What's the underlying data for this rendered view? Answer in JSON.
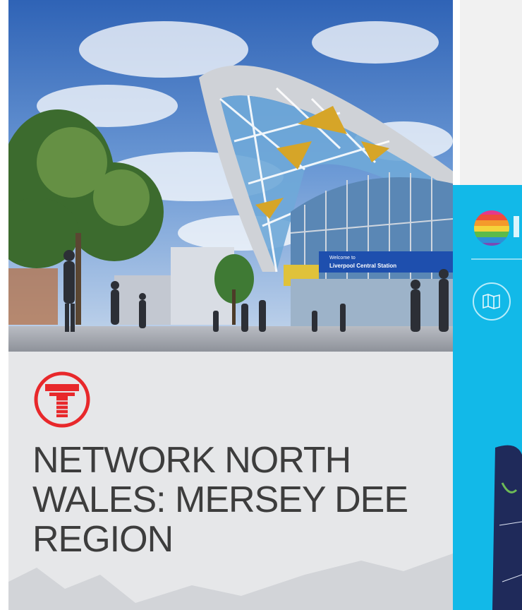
{
  "hero": {
    "sign_line1": "Welcome to",
    "sign_line2": "Liverpool Central Station"
  },
  "title_lines": [
    "NETWORK NORTH",
    "WALES: MERSEY DEE",
    "REGION"
  ],
  "colors": {
    "logo_red": "#e8282b",
    "title_gray": "#3d3d3d",
    "card_bg": "#e6e7e9",
    "right_panel_cyan": "#12b9e8",
    "sky_blue": "#4a7fc8",
    "station_sign_blue": "#1e4fae"
  },
  "icons": {
    "logo": "transport-t-logo",
    "rainbow": "rainbow-ball-logo",
    "map": "map-icon"
  }
}
